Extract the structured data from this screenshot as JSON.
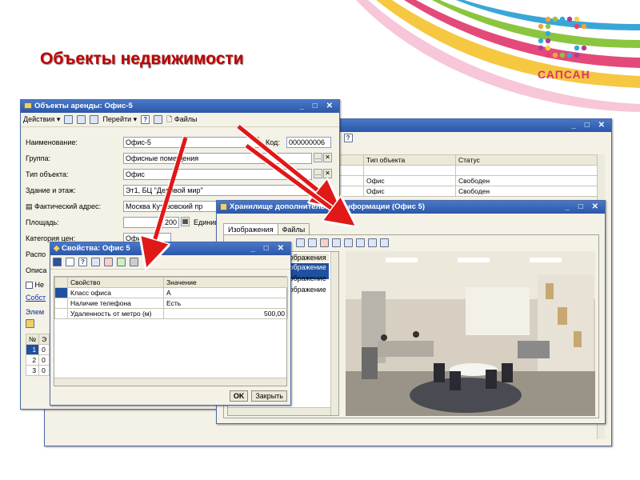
{
  "slide": {
    "title": "Объекты недвижимости"
  },
  "logo": {
    "text": "САПСАН"
  },
  "back_window": {
    "columns": [
      "Тип объекта",
      "Статус"
    ],
    "partial_header": "ля",
    "rows": [
      [
        "Офис",
        "Свободен"
      ],
      [
        "Офис",
        "Свободен"
      ]
    ],
    "search_arrow": "▾",
    "help": "?"
  },
  "rental_window": {
    "title": "Объекты аренды: Офис-5",
    "toolbar": {
      "actions": "Действия ▾",
      "goto": "Перейти ▾",
      "help": "?",
      "files": "Файлы"
    },
    "fields": {
      "name_label": "Наименование:",
      "name_value": "Офис-5",
      "code_label": "Код:",
      "code_value": "000000006",
      "group_label": "Группа:",
      "group_value": "Офисные помещения",
      "type_label": "Тип объекта:",
      "type_value": "Офис",
      "building_label": "Здание и этаж:",
      "building_value": "Эт1, БЦ \"Деловой мир\"",
      "address_label": "Фактический адрес:",
      "address_value": "Москва Кутузовский пр",
      "area_label": "Площадь:",
      "area_value": "200",
      "unit_label": "Единица",
      "price_cat_label": "Категория цен:",
      "price_cat_value": "Офис",
      "location_label": "Распо",
      "description_label": "Описа",
      "checkbox_label": "Не",
      "owner_link": "Собст",
      "elements_label": "Элем"
    },
    "elements_table": {
      "header": [
        "№",
        "Э"
      ],
      "rows": [
        [
          "1",
          "0"
        ],
        [
          "2",
          "0"
        ],
        [
          "3",
          "0"
        ]
      ]
    },
    "close_ctrls": "_ □ ✕"
  },
  "storage_window": {
    "title": "Хранилище дополнительной информации (Офис 5)",
    "tabs": [
      "Изображения",
      "Файлы"
    ],
    "list": {
      "header": "Изображения",
      "items": [
        "Изображение 1",
        "Изображение 2",
        "Изображение 3"
      ]
    },
    "ctrls": "_ □ ✕"
  },
  "props_window": {
    "title": "Свойства: Офис 5",
    "columns": [
      "Свойство",
      "Значение"
    ],
    "rows": [
      [
        "Класс офиса",
        "А"
      ],
      [
        "Наличие телефона",
        "Есть"
      ],
      [
        "Удаленность от метро (м)",
        "500,00"
      ]
    ],
    "ok": "OK",
    "close": "Закрыть",
    "ctrls": "_ □ ✕"
  },
  "icons": [
    "save-icon",
    "help-icon",
    "add-icon",
    "delete-icon",
    "files-icon",
    "refresh-icon"
  ]
}
